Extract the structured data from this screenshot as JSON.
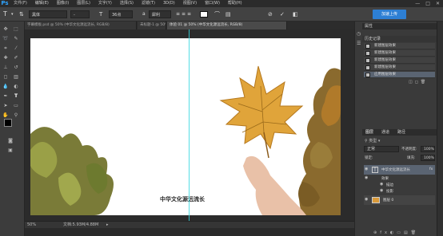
{
  "app": {
    "logo": "Ps"
  },
  "menu": [
    "文件(F)",
    "编辑(E)",
    "图像(I)",
    "图层(L)",
    "文字(Y)",
    "选择(S)",
    "滤镜(T)",
    "3D(D)",
    "视图(V)",
    "窗口(W)",
    "帮助(H)"
  ],
  "window_controls": [
    "—",
    "□",
    "✕"
  ],
  "options": {
    "font_family": "黑体",
    "font_style": "-",
    "font_size": "36点",
    "antialias": "犀利",
    "cloud_button": "加速上传"
  },
  "tabs": [
    {
      "label": "字幕模板.psd @ 50% (中华文化源远流长, RGB/8)",
      "active": false
    },
    {
      "label": "未标题-1 @ 50%...",
      "active": false
    },
    {
      "label": "体验 01 @ 50% (中华文化源远流长, RGB/8)",
      "active": true
    }
  ],
  "canvas": {
    "subtitle": "中华文化源远流长"
  },
  "status": {
    "zoom": "50%",
    "doc_size": "文档:5.93M/4.88M"
  },
  "history": {
    "title": "历史记录",
    "tab2": "属性",
    "items": [
      "新建图层效果",
      "新建图层效果",
      "新建图层效果",
      "新建图层效果",
      "应用图层效果"
    ]
  },
  "layers": {
    "tabs": [
      "图层",
      "通道",
      "路径"
    ],
    "blend_mode": "正常",
    "opacity_label": "不透明度:",
    "opacity": "100%",
    "lock_label": "锁定:",
    "fill_label": "填充:",
    "fill": "100%",
    "items": [
      {
        "name": "中华文化源远流长",
        "type": "text"
      },
      {
        "name": "效果",
        "type": "fx"
      },
      {
        "name": "描边",
        "type": "effect"
      },
      {
        "name": "投影",
        "type": "effect"
      },
      {
        "name": "图层 0",
        "type": "image"
      }
    ]
  },
  "colors": {
    "accent": "#2d7fd4",
    "guide": "#36d8e0"
  }
}
